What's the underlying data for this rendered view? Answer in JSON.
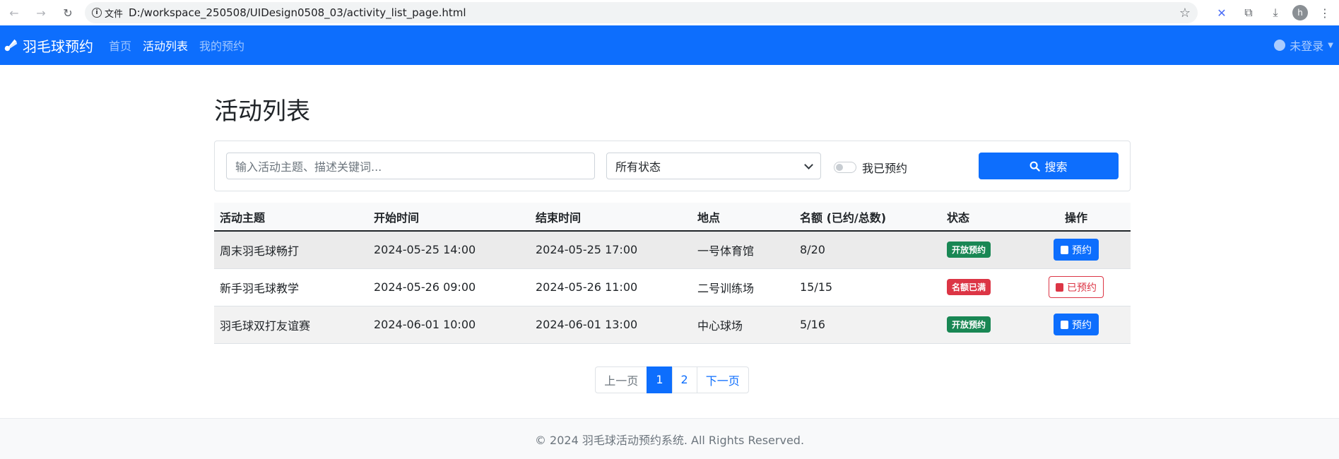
{
  "browser": {
    "info_label": "文件",
    "url": "D:/workspace_250508/UIDesign0508_03/activity_list_page.html",
    "avatar_letter": "h"
  },
  "navbar": {
    "brand": "羽毛球预约",
    "links": [
      {
        "label": "首页",
        "active": false
      },
      {
        "label": "活动列表",
        "active": true
      },
      {
        "label": "我的预约",
        "active": false
      }
    ],
    "user_label": "未登录"
  },
  "page_title": "活动列表",
  "search": {
    "placeholder": "输入活动主题、描述关键词...",
    "status_selected": "所有状态",
    "switch_label": "我已预约",
    "button_label": "搜索"
  },
  "table": {
    "headers": [
      "活动主题",
      "开始时间",
      "结束时间",
      "地点",
      "名额 (已约/总数)",
      "状态",
      "操作"
    ],
    "rows": [
      {
        "title": "周末羽毛球畅打",
        "start": "2024-05-25 14:00",
        "end": "2024-05-25 17:00",
        "location": "一号体育馆",
        "quota": "8/20",
        "status": "开放预约",
        "action": "预约"
      },
      {
        "title": "新手羽毛球教学",
        "start": "2024-05-26 09:00",
        "end": "2024-05-26 11:00",
        "location": "二号训练场",
        "quota": "15/15",
        "status": "名额已满",
        "action": "已预约"
      },
      {
        "title": "羽毛球双打友谊赛",
        "start": "2024-06-01 10:00",
        "end": "2024-06-01 13:00",
        "location": "中心球场",
        "quota": "5/16",
        "status": "开放预约",
        "action": "预约"
      }
    ]
  },
  "pagination": {
    "prev": "上一页",
    "pages": [
      "1",
      "2"
    ],
    "next": "下一页"
  },
  "footer": "© 2024 羽毛球活动预约系统. All Rights Reserved.",
  "colors": {
    "primary": "#0d6efd",
    "success": "#198754",
    "danger": "#dc3545"
  }
}
